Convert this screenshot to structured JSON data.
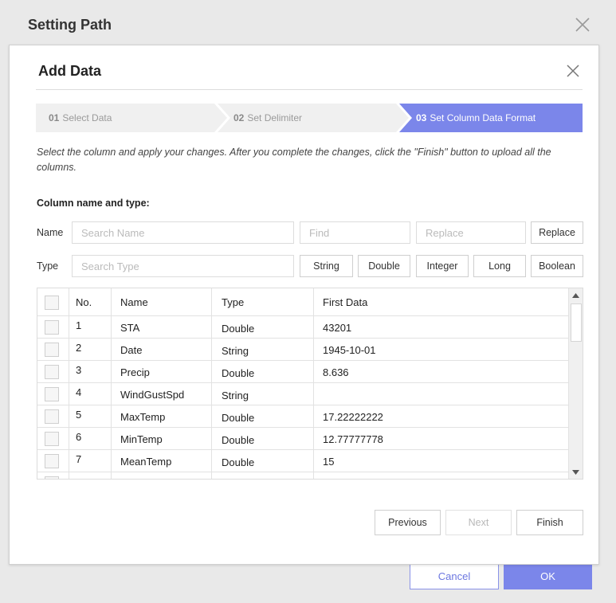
{
  "outer": {
    "title": "Setting Path",
    "cancel_label": "Cancel",
    "ok_label": "OK"
  },
  "dialog": {
    "title": "Add Data",
    "steps": [
      {
        "num": "01",
        "label": "Select Data",
        "active": false
      },
      {
        "num": "02",
        "label": "Set Delimiter",
        "active": false
      },
      {
        "num": "03",
        "label": "Set Column Data Format",
        "active": true
      }
    ],
    "instructions": "Select the column and apply your changes. After you complete the changes, click the \"Finish\" button to upload all the columns.",
    "section_label": "Column name and type:",
    "name_row": {
      "label": "Name",
      "search_placeholder": "Search Name",
      "find_placeholder": "Find",
      "replace_placeholder": "Replace",
      "replace_button": "Replace"
    },
    "type_row": {
      "label": "Type",
      "search_placeholder": "Search Type",
      "types": [
        "String",
        "Double",
        "Integer",
        "Long",
        "Boolean"
      ]
    },
    "table": {
      "headers": [
        "No.",
        "Name",
        "Type",
        "First Data"
      ],
      "rows": [
        {
          "no": "1",
          "name": "STA",
          "type": "Double",
          "first": "43201"
        },
        {
          "no": "2",
          "name": "Date",
          "type": "String",
          "first": "1945-10-01"
        },
        {
          "no": "3",
          "name": "Precip",
          "type": "Double",
          "first": "8.636"
        },
        {
          "no": "4",
          "name": "WindGustSpd",
          "type": "String",
          "first": ""
        },
        {
          "no": "5",
          "name": "MaxTemp",
          "type": "Double",
          "first": "17.22222222"
        },
        {
          "no": "6",
          "name": "MinTemp",
          "type": "Double",
          "first": "12.77777778"
        },
        {
          "no": "7",
          "name": "MeanTemp",
          "type": "Double",
          "first": "15"
        }
      ]
    },
    "footer": {
      "previous": "Previous",
      "next": "Next",
      "finish": "Finish"
    }
  },
  "colors": {
    "accent": "#7b86ea",
    "step_inactive": "#f0f0f0"
  }
}
